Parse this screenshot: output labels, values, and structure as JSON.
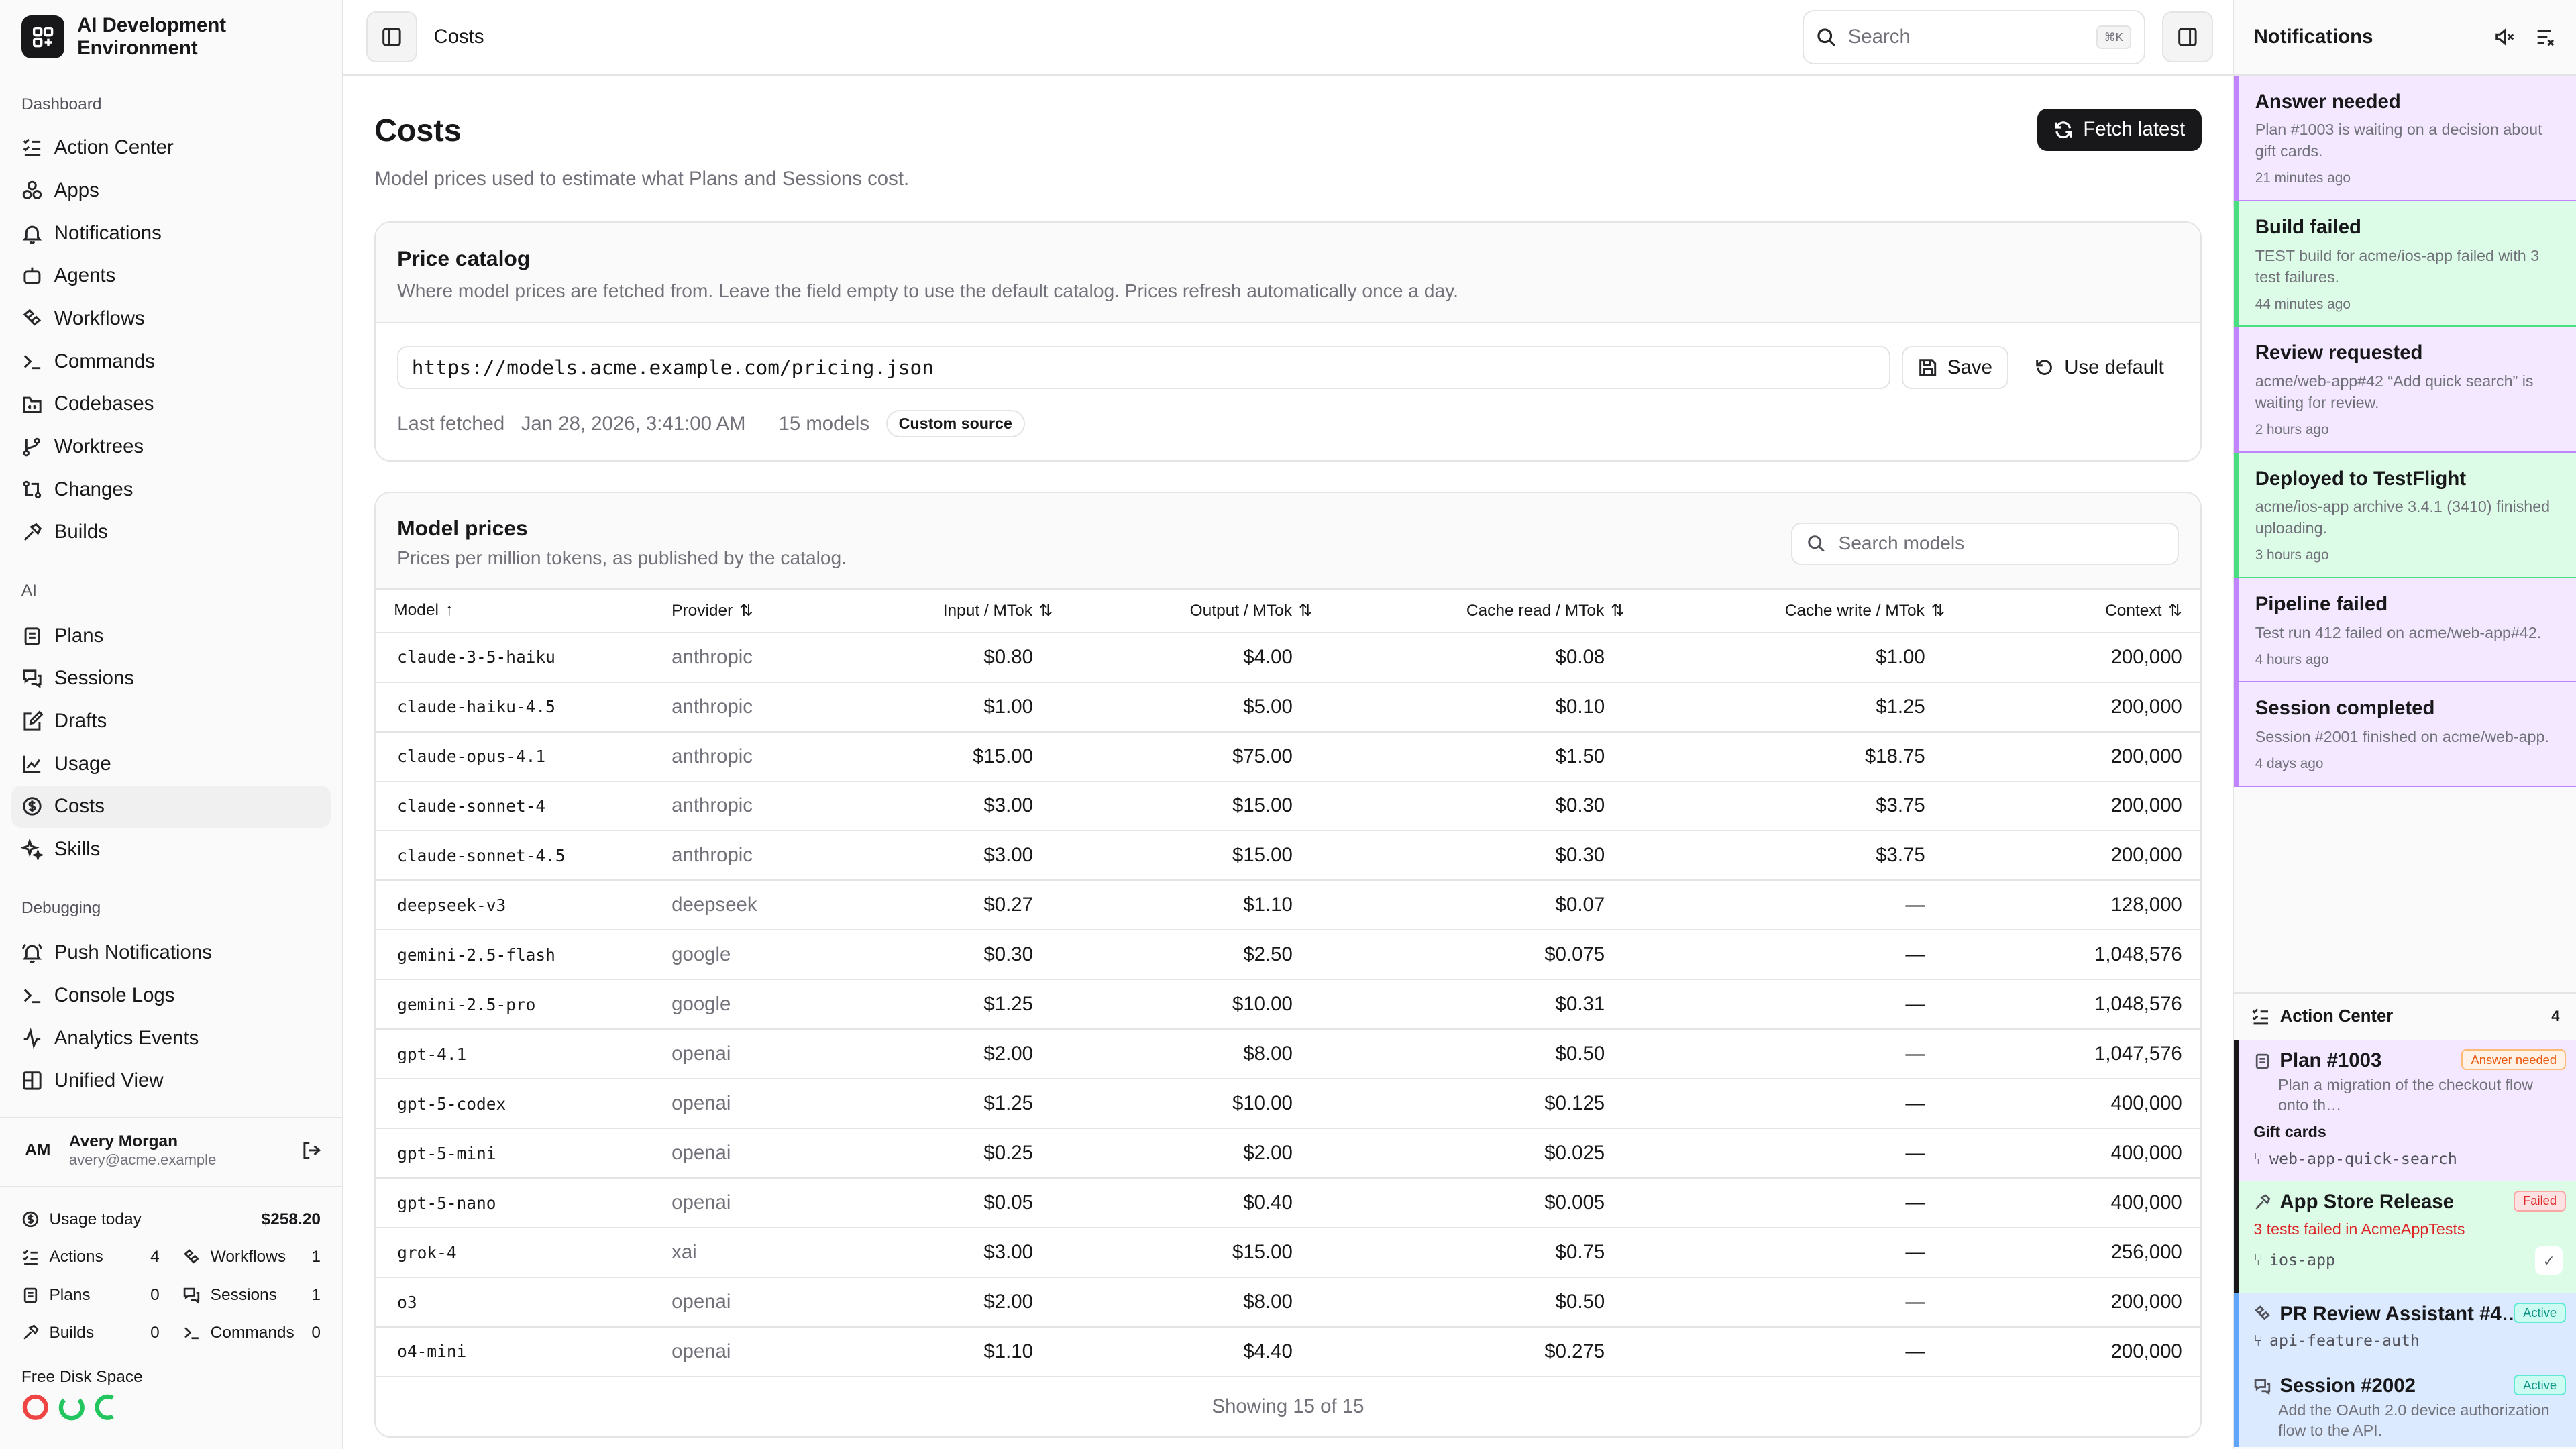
{
  "app": {
    "title": "AI Development Environment"
  },
  "sidebar": {
    "sections": [
      {
        "label": "Dashboard",
        "items": [
          {
            "label": "Action Center",
            "icon": "list-check-icon"
          },
          {
            "label": "Apps",
            "icon": "apps-icon"
          },
          {
            "label": "Notifications",
            "icon": "bell-icon"
          },
          {
            "label": "Agents",
            "icon": "bot-icon"
          },
          {
            "label": "Workflows",
            "icon": "workflow-icon"
          },
          {
            "label": "Commands",
            "icon": "terminal-icon"
          },
          {
            "label": "Codebases",
            "icon": "folder-code-icon"
          },
          {
            "label": "Worktrees",
            "icon": "git-branch-icon"
          },
          {
            "label": "Changes",
            "icon": "git-compare-icon"
          },
          {
            "label": "Builds",
            "icon": "hammer-icon"
          }
        ]
      },
      {
        "label": "AI",
        "items": [
          {
            "label": "Plans",
            "icon": "clipboard-icon"
          },
          {
            "label": "Sessions",
            "icon": "chat-icon"
          },
          {
            "label": "Drafts",
            "icon": "draft-icon"
          },
          {
            "label": "Usage",
            "icon": "chart-line-icon"
          },
          {
            "label": "Costs",
            "icon": "dollar-circle-icon",
            "active": true
          },
          {
            "label": "Skills",
            "icon": "sparkle-icon"
          }
        ]
      },
      {
        "label": "Debugging",
        "items": [
          {
            "label": "Push Notifications",
            "icon": "bell-ring-icon"
          },
          {
            "label": "Console Logs",
            "icon": "terminal-icon"
          },
          {
            "label": "Analytics Events",
            "icon": "activity-icon"
          },
          {
            "label": "Unified View",
            "icon": "layout-icon"
          }
        ]
      }
    ],
    "user": {
      "initials": "AM",
      "name": "Avery Morgan",
      "email": "avery@acme.example"
    },
    "usage": {
      "label": "Usage today",
      "value": "$258.20"
    },
    "stats": [
      {
        "label": "Actions",
        "value": "4"
      },
      {
        "label": "Workflows",
        "value": "1"
      },
      {
        "label": "Plans",
        "value": "0"
      },
      {
        "label": "Sessions",
        "value": "1"
      },
      {
        "label": "Builds",
        "value": "0"
      },
      {
        "label": "Commands",
        "value": "0"
      }
    ],
    "disk_label": "Free Disk Space",
    "disk_colors": [
      "#ef4444",
      "#22c55e",
      "#22c55e"
    ]
  },
  "topbar": {
    "breadcrumb": "Costs",
    "search_placeholder": "Search",
    "shortcut": "⌘K"
  },
  "page": {
    "title": "Costs",
    "subtitle": "Model prices used to estimate what Plans and Sessions cost.",
    "fetch_label": "Fetch latest"
  },
  "catalog": {
    "title": "Price catalog",
    "description": "Where model prices are fetched from. Leave the field empty to use the default catalog. Prices refresh automatically once a day.",
    "url": "https://models.acme.example.com/pricing.json",
    "save_label": "Save",
    "default_label": "Use default",
    "last_fetched_label": "Last fetched",
    "last_fetched_value": "Jan 28, 2026, 3:41:00 AM",
    "models_count": "15 models",
    "source_chip": "Custom source"
  },
  "prices": {
    "title": "Model prices",
    "description": "Prices per million tokens, as published by the catalog.",
    "search_placeholder": "Search models",
    "columns": [
      "Model",
      "Provider",
      "Input / MTok",
      "Output / MTok",
      "Cache read / MTok",
      "Cache write / MTok",
      "Context"
    ],
    "rows": [
      [
        "claude-3-5-haiku",
        "anthropic",
        "$0.80",
        "$4.00",
        "$0.08",
        "$1.00",
        "200,000"
      ],
      [
        "claude-haiku-4.5",
        "anthropic",
        "$1.00",
        "$5.00",
        "$0.10",
        "$1.25",
        "200,000"
      ],
      [
        "claude-opus-4.1",
        "anthropic",
        "$15.00",
        "$75.00",
        "$1.50",
        "$18.75",
        "200,000"
      ],
      [
        "claude-sonnet-4",
        "anthropic",
        "$3.00",
        "$15.00",
        "$0.30",
        "$3.75",
        "200,000"
      ],
      [
        "claude-sonnet-4.5",
        "anthropic",
        "$3.00",
        "$15.00",
        "$0.30",
        "$3.75",
        "200,000"
      ],
      [
        "deepseek-v3",
        "deepseek",
        "$0.27",
        "$1.10",
        "$0.07",
        "—",
        "128,000"
      ],
      [
        "gemini-2.5-flash",
        "google",
        "$0.30",
        "$2.50",
        "$0.075",
        "—",
        "1,048,576"
      ],
      [
        "gemini-2.5-pro",
        "google",
        "$1.25",
        "$10.00",
        "$0.31",
        "—",
        "1,048,576"
      ],
      [
        "gpt-4.1",
        "openai",
        "$2.00",
        "$8.00",
        "$0.50",
        "—",
        "1,047,576"
      ],
      [
        "gpt-5-codex",
        "openai",
        "$1.25",
        "$10.00",
        "$0.125",
        "—",
        "400,000"
      ],
      [
        "gpt-5-mini",
        "openai",
        "$0.25",
        "$2.00",
        "$0.025",
        "—",
        "400,000"
      ],
      [
        "gpt-5-nano",
        "openai",
        "$0.05",
        "$0.40",
        "$0.005",
        "—",
        "400,000"
      ],
      [
        "grok-4",
        "xai",
        "$3.00",
        "$15.00",
        "$0.75",
        "—",
        "256,000"
      ],
      [
        "o3",
        "openai",
        "$2.00",
        "$8.00",
        "$0.50",
        "—",
        "200,000"
      ],
      [
        "o4-mini",
        "openai",
        "$1.10",
        "$4.40",
        "$0.275",
        "—",
        "200,000"
      ]
    ],
    "footer": "Showing 15 of 15"
  },
  "notifications": {
    "title": "Notifications",
    "items": [
      {
        "title": "Answer needed",
        "desc": "Plan #1003 is waiting on a decision about gift cards.",
        "age": "21 minutes ago",
        "tone": "purple"
      },
      {
        "title": "Build failed",
        "desc": "TEST build for acme/ios-app failed with 3 test failures.",
        "age": "44 minutes ago",
        "tone": "green"
      },
      {
        "title": "Review requested",
        "desc": "acme/web-app#42 “Add quick search” is waiting for review.",
        "age": "2 hours ago",
        "tone": "purple"
      },
      {
        "title": "Deployed to TestFlight",
        "desc": "acme/ios-app archive 3.4.1 (3410) finished uploading.",
        "age": "3 hours ago",
        "tone": "green"
      },
      {
        "title": "Pipeline failed",
        "desc": "Test run 412 failed on acme/web-app#42.",
        "age": "4 hours ago",
        "tone": "purple"
      },
      {
        "title": "Session completed",
        "desc": "Session #2001 finished on acme/web-app.",
        "age": "4 days ago",
        "tone": "purple"
      }
    ]
  },
  "action_center": {
    "title": "Action Center",
    "count": "4",
    "items": [
      {
        "title": "Plan #1003",
        "badge": "Answer needed",
        "desc": "Plan a migration of the checkout flow onto th…",
        "extra": "Gift cards",
        "branch": "web-app-quick-search"
      },
      {
        "title": "App Store Release",
        "badge": "Failed",
        "error": "3 tests failed in AcmeAppTests",
        "branch": "ios-app"
      },
      {
        "title": "PR Review Assistant #4…",
        "badge": "Active",
        "branch": "api-feature-auth"
      },
      {
        "title": "Session #2002",
        "badge": "Active",
        "desc": "Add the OAuth 2.0 device authorization flow to the API."
      }
    ]
  }
}
